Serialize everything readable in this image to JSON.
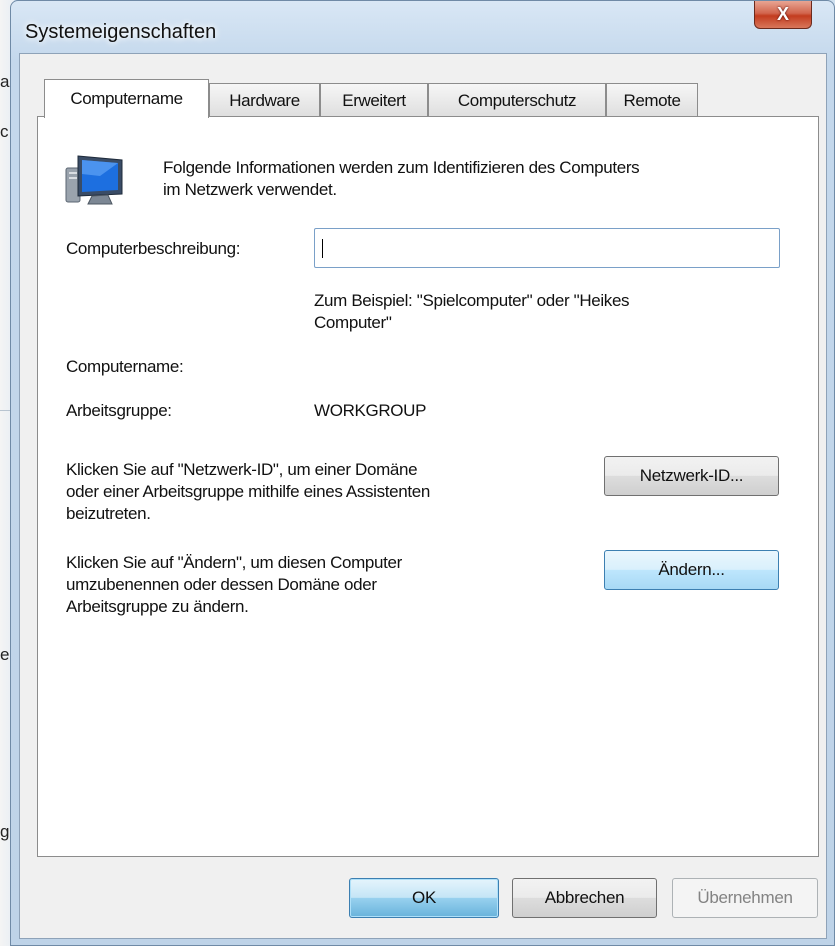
{
  "background": {
    "fragments": [
      "a",
      "c",
      "er",
      "g"
    ]
  },
  "window": {
    "title": "Systemeigenschaften",
    "close_label": "X"
  },
  "tabs": [
    {
      "label": "Computername",
      "active": true
    },
    {
      "label": "Hardware",
      "active": false
    },
    {
      "label": "Erweitert",
      "active": false
    },
    {
      "label": "Computerschutz",
      "active": false
    },
    {
      "label": "Remote",
      "active": false
    }
  ],
  "computer_name_page": {
    "icon": "computer-icon",
    "intro_line1": "Folgende Informationen werden zum Identifizieren des Computers",
    "intro_line2": "im Netzwerk verwendet.",
    "description_label": "Computerbeschreibung:",
    "description_value": "",
    "example_line1": "Zum Beispiel: \"Spielcomputer\" oder \"Heikes",
    "example_line2": "Computer\"",
    "computer_name_label": "Computername:",
    "computer_name_value": "",
    "workgroup_label": "Arbeitsgruppe:",
    "workgroup_value": "WORKGROUP",
    "network_id_text_line1": "Klicken Sie auf \"Netzwerk-ID\", um einer Domäne",
    "network_id_text_line2": "oder einer Arbeitsgruppe mithilfe eines Assistenten",
    "network_id_text_line3": "beizutreten.",
    "network_id_button": "Netzwerk-ID...",
    "change_text_line1": "Klicken Sie auf \"Ändern\", um diesen Computer",
    "change_text_line2": "umzubenennen oder dessen Domäne oder",
    "change_text_line3": "Arbeitsgruppe zu ändern.",
    "change_button": "Ändern..."
  },
  "footer": {
    "ok_label": "OK",
    "cancel_label": "Abbrechen",
    "apply_label": "Übernehmen"
  }
}
